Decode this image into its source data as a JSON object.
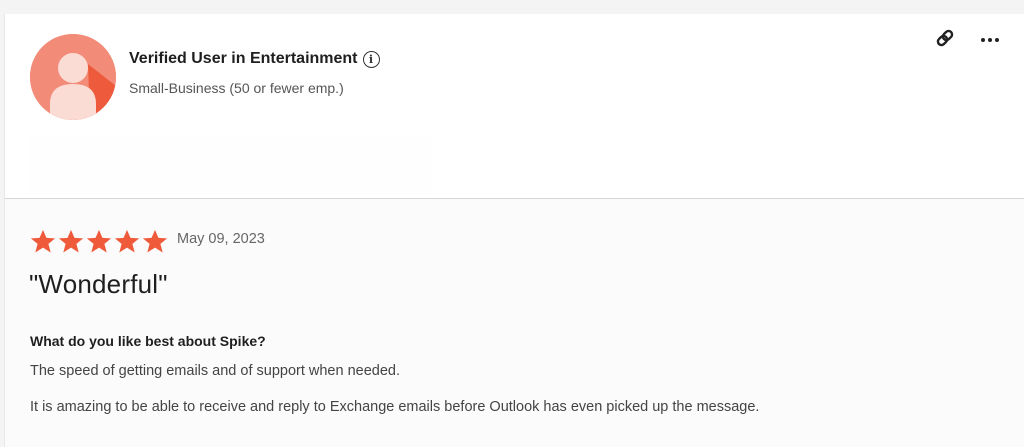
{
  "reviewer": {
    "name": "Verified User in Entertainment",
    "segment": "Small-Business (50 or fewer emp.)",
    "avatar_color": "#f28b78",
    "avatar_accent": "#ee5a3c"
  },
  "header_actions": {
    "link_icon": "link-icon",
    "more_icon": "more-options-icon"
  },
  "review": {
    "rating": 5,
    "rating_max": 5,
    "star_color": "#ef5a3a",
    "date": "May 09, 2023",
    "title": "\"Wonderful\"",
    "question": "What do you like best about Spike?",
    "answer_paragraphs": [
      "The speed of getting emails and of support when needed.",
      "It is amazing to be able to receive and reply to Exchange emails before Outlook has even picked up the message."
    ]
  }
}
